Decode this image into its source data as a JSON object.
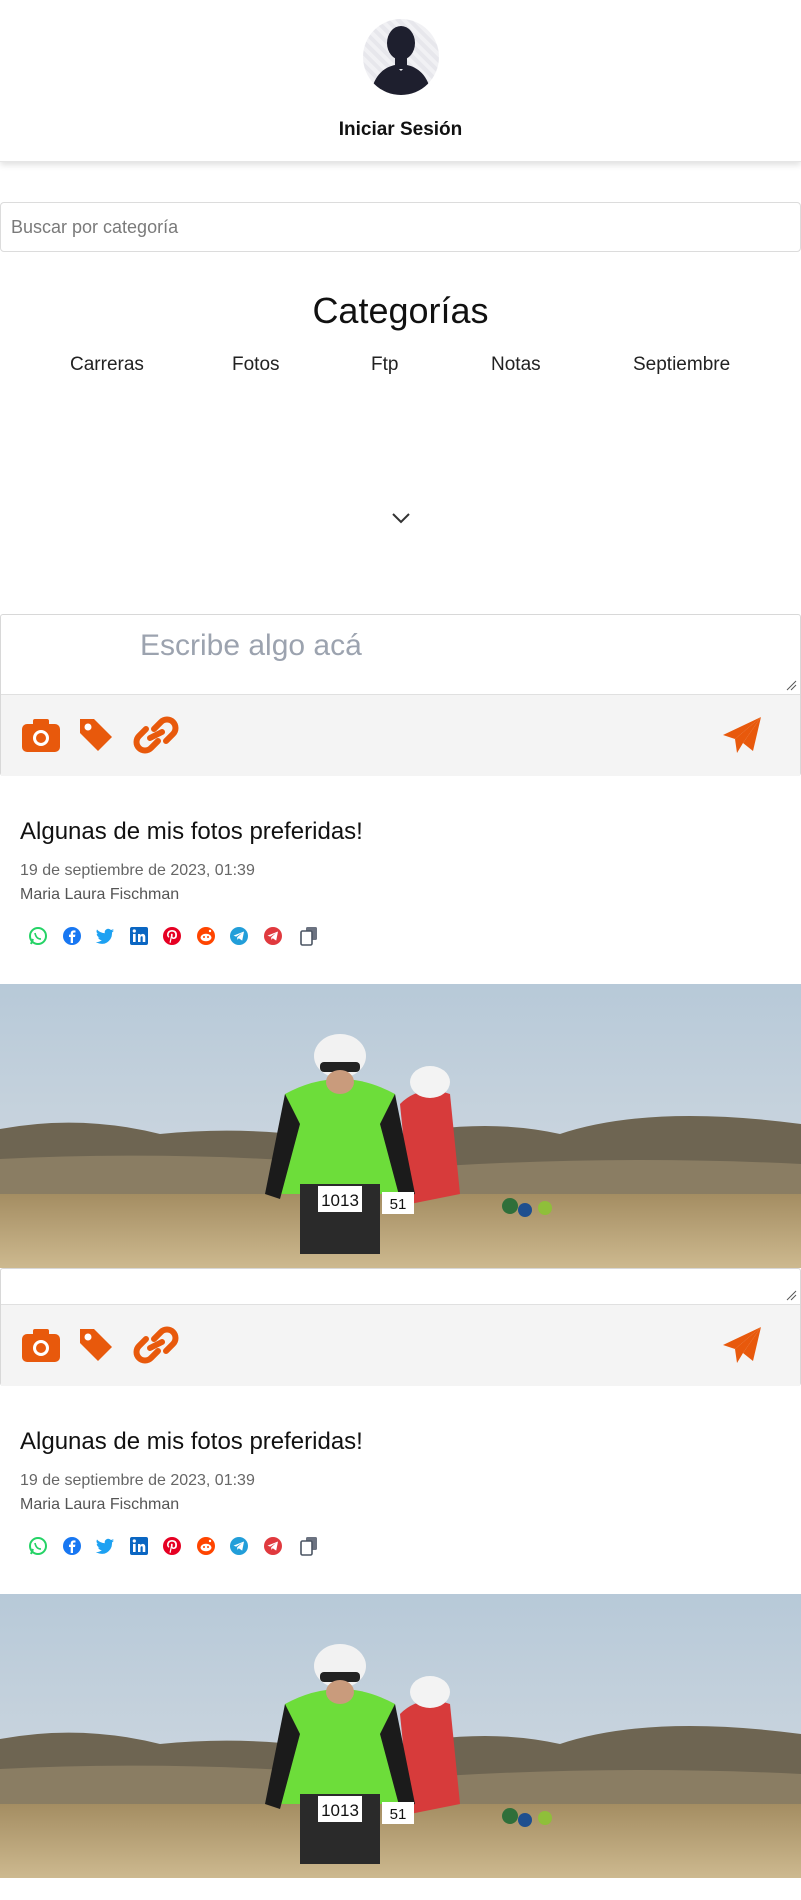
{
  "header": {
    "login_label": "Iniciar Sesión"
  },
  "search": {
    "placeholder": "Buscar por categoría"
  },
  "categories": {
    "title": "Categorías",
    "items": [
      "Carreras",
      "Fotos",
      "Ftp",
      "Notas",
      "Septiembre"
    ]
  },
  "composer": {
    "placeholder": "Escribe algo acá"
  },
  "posts": [
    {
      "title": "Algunas de mis fotos preferidas!",
      "date": "19 de septiembre de 2023, 01:39",
      "author": "Maria Laura Fischman"
    },
    {
      "title": "Algunas de mis fotos preferidas!",
      "date": "19 de septiembre de 2023, 01:39",
      "author": "Maria Laura Fischman"
    }
  ],
  "share_icons": [
    "whatsapp-icon",
    "facebook-icon",
    "twitter-icon",
    "linkedin-icon",
    "pinterest-icon",
    "reddit-icon",
    "telegram-icon",
    "telegram-alt-icon",
    "copy-icon"
  ],
  "image_badges": {
    "bib_left": "1013",
    "bib_right": "51"
  },
  "colors": {
    "accent": "#e8590c",
    "text": "#111111",
    "muted": "#666666",
    "toolbar_bg": "#f4f4f4"
  }
}
